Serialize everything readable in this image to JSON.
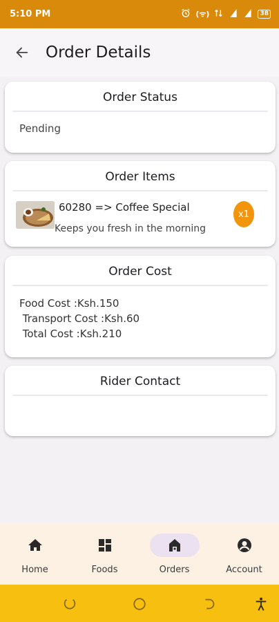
{
  "status_bar": {
    "time": "5:10 PM",
    "signal_label": "(ᯤ)",
    "battery": "38"
  },
  "header": {
    "title": "Order Details"
  },
  "order_status": {
    "title": "Order Status",
    "value": "Pending"
  },
  "order_items": {
    "title": "Order Items",
    "items": [
      {
        "name": "60280 => Coffee Special",
        "description": "Keeps you fresh in the morning",
        "quantity": "x1"
      }
    ]
  },
  "order_cost": {
    "title": "Order Cost",
    "food_cost": "Food Cost :Ksh.150",
    "transport_cost": " Transport Cost :Ksh.60",
    "total_cost": " Total Cost :Ksh.210"
  },
  "rider_contact": {
    "title": "Rider Contact"
  },
  "bottom_nav": {
    "items": [
      {
        "label": "Home",
        "icon": "home-icon",
        "active": false
      },
      {
        "label": "Foods",
        "icon": "dashboard-icon",
        "active": false
      },
      {
        "label": "Orders",
        "icon": "orders-icon",
        "active": true
      },
      {
        "label": "Account",
        "icon": "account-circle-icon",
        "active": false
      }
    ]
  },
  "colors": {
    "status_bar": "#d98a0a",
    "accent": "#f2950d",
    "nav_bar": "#fdf1e3",
    "system_nav": "#f7bf0f",
    "active_pill": "#ece1f0"
  }
}
